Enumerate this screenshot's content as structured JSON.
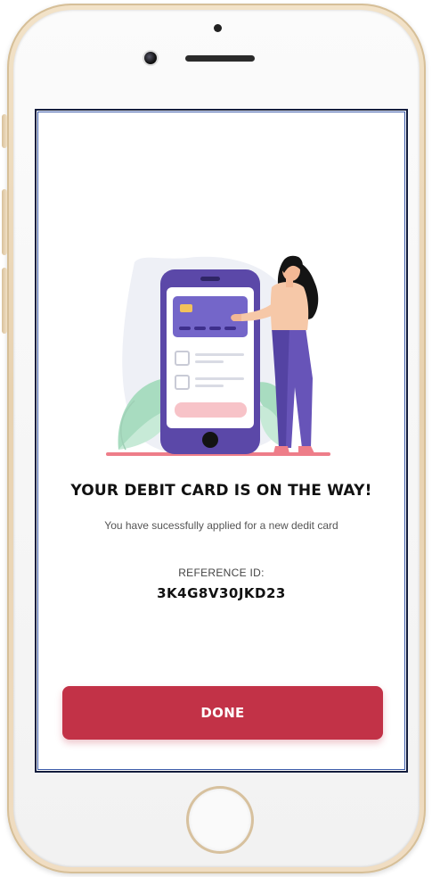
{
  "confirmation": {
    "headline": "YOUR DEBIT CARD IS ON THE WAY!",
    "subline": "You have sucessfully applied for a new dedit card",
    "reference_label": "REFERENCE ID:",
    "reference_id": "3K4G8V30JKD23"
  },
  "actions": {
    "done_label": "DONE"
  },
  "colors": {
    "primary": "#c23247",
    "illustration_purple": "#5b48a8",
    "card_purple": "#7466c9",
    "accent_pink": "#f0a0a8",
    "leaf_green": "#a8dcc0"
  },
  "icons": {
    "illustration": "phone-with-card-and-woman-illustration"
  }
}
